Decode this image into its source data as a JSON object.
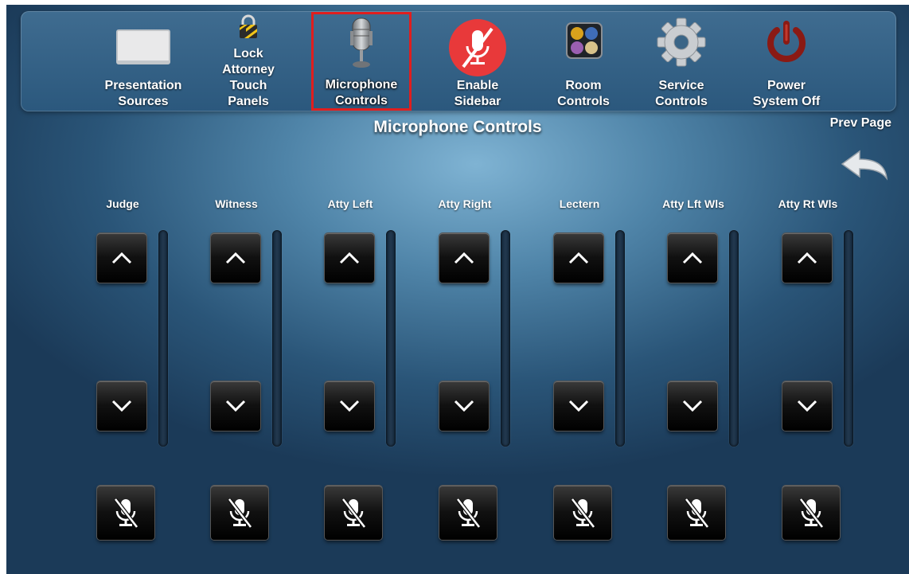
{
  "nav": {
    "items": [
      {
        "label": "Presentation Sources"
      },
      {
        "label": "Lock Attorney Touch Panels"
      },
      {
        "label": "Microphone Controls",
        "selected": true
      },
      {
        "label": "Enable Sidebar"
      },
      {
        "label": "Room Controls"
      },
      {
        "label": "Service Controls"
      },
      {
        "label": "Power System Off"
      }
    ]
  },
  "page": {
    "title": "Microphone Controls",
    "prev_page_label": "Prev Page"
  },
  "channels": [
    {
      "label": "Judge"
    },
    {
      "label": "Witness"
    },
    {
      "label": "Atty Left"
    },
    {
      "label": "Atty Right"
    },
    {
      "label": "Lectern"
    },
    {
      "label": "Atty Lft Wls"
    },
    {
      "label": "Atty Rt Wls"
    }
  ],
  "colors": {
    "selection_outline": "#e01e1e",
    "enable_sidebar_icon": "#e8393a",
    "power_icon": "#8a1a14"
  },
  "icons": {
    "presentation_sources": "screen-icon",
    "lock": "padlock-icon",
    "microphone": "microphone-icon",
    "sidebar": "muted-microphone-icon",
    "room": "room-controls-icon",
    "service": "gear-icon",
    "power": "power-icon",
    "prev": "back-arrow-icon",
    "volume_up": "chevron-up-icon",
    "volume_down": "chevron-down-icon",
    "mute": "mic-mute-icon"
  }
}
